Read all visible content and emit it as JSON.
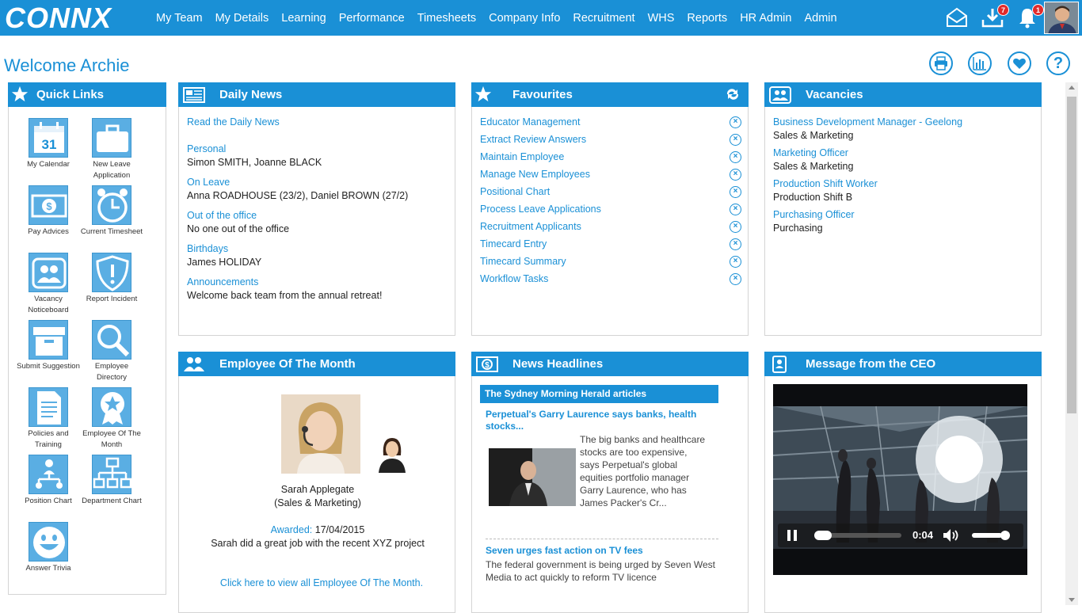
{
  "brand": {
    "logo_text": "CONNX",
    "color_primary": "#1a90d6"
  },
  "nav": [
    "My Team",
    "My Details",
    "Learning",
    "Performance",
    "Timesheets",
    "Company Info",
    "Recruitment",
    "WHS",
    "Reports",
    "HR Admin",
    "Admin"
  ],
  "top_icons": {
    "downloads_count": "7",
    "alerts_count": "1"
  },
  "welcome": "Welcome Archie",
  "tools": [
    "print-icon",
    "chart-icon",
    "heart-icon",
    "help-icon"
  ],
  "quick_links": {
    "title": "Quick Links",
    "items": [
      {
        "label": "My Calendar",
        "icon": "calendar-icon",
        "num": "31"
      },
      {
        "label": "New Leave Application",
        "icon": "suitcase-icon"
      },
      {
        "label": "Pay Advices",
        "icon": "money-icon"
      },
      {
        "label": "Current Timesheet",
        "icon": "clock-icon"
      },
      {
        "label": "Vacancy Noticeboard",
        "icon": "people-icon"
      },
      {
        "label": "Report Incident",
        "icon": "shield-alert-icon"
      },
      {
        "label": "Submit Suggestion",
        "icon": "box-icon"
      },
      {
        "label": "Employee Directory",
        "icon": "magnifier-icon"
      },
      {
        "label": "Policies and Training",
        "icon": "document-icon"
      },
      {
        "label": "Employee Of The Month",
        "icon": "award-icon"
      },
      {
        "label": "Position Chart",
        "icon": "org-chart-icon"
      },
      {
        "label": "Department Chart",
        "icon": "hierarchy-icon"
      },
      {
        "label": "Answer Trivia",
        "icon": "smiley-icon"
      }
    ]
  },
  "daily_news": {
    "title": "Daily News",
    "read_link": "Read the Daily News",
    "sections": [
      {
        "heading": "Personal",
        "text": "Simon SMITH, Joanne BLACK"
      },
      {
        "heading": "On Leave",
        "text": "Anna ROADHOUSE (23/2), Daniel BROWN (27/2)"
      },
      {
        "heading": "Out of the office",
        "text": "No one out of the office"
      },
      {
        "heading": "Birthdays",
        "text": "James HOLIDAY"
      },
      {
        "heading": "Announcements",
        "text": "Welcome back team from the annual retreat!"
      }
    ]
  },
  "favourites": {
    "title": "Favourites",
    "items": [
      "Educator Management",
      "Extract Review Answers",
      "Maintain Employee",
      "Manage New Employees",
      "Positional Chart",
      "Process Leave Applications",
      "Recruitment Applicants",
      "Timecard Entry",
      "Timecard Summary",
      "Workflow Tasks"
    ]
  },
  "vacancies": {
    "title": "Vacancies",
    "items": [
      {
        "title": "Business Development Manager - Geelong",
        "dept": "Sales & Marketing"
      },
      {
        "title": "Marketing Officer",
        "dept": "Sales & Marketing"
      },
      {
        "title": "Production Shift Worker",
        "dept": "Production Shift B"
      },
      {
        "title": "Purchasing Officer",
        "dept": "Purchasing"
      }
    ]
  },
  "eotm": {
    "title": "Employee Of The Month",
    "name": "Sarah Applegate",
    "dept": "(Sales & Marketing)",
    "awarded_label": "Awarded:",
    "awarded_date": "17/04/2015",
    "comment": "Sarah did a great job with the recent XYZ project",
    "view_all": "Click here to view all Employee Of The Month."
  },
  "news_headlines": {
    "title": "News Headlines",
    "source": "The Sydney Morning Herald articles",
    "articles": [
      {
        "headline": "Perpetual's Garry Laurence says banks, health stocks...",
        "body": "The big banks and healthcare stocks are too expensive, says Perpetual's global equities portfolio manager Garry Laurence, who has James Packer's Cr..."
      },
      {
        "headline": "Seven urges fast action on TV fees",
        "body": "The federal government is being urged by Seven West Media to act quickly to reform TV licence"
      }
    ]
  },
  "ceo": {
    "title": "Message from the CEO",
    "video_time": "0:04",
    "progress": 0.06,
    "volume": 0.8
  }
}
